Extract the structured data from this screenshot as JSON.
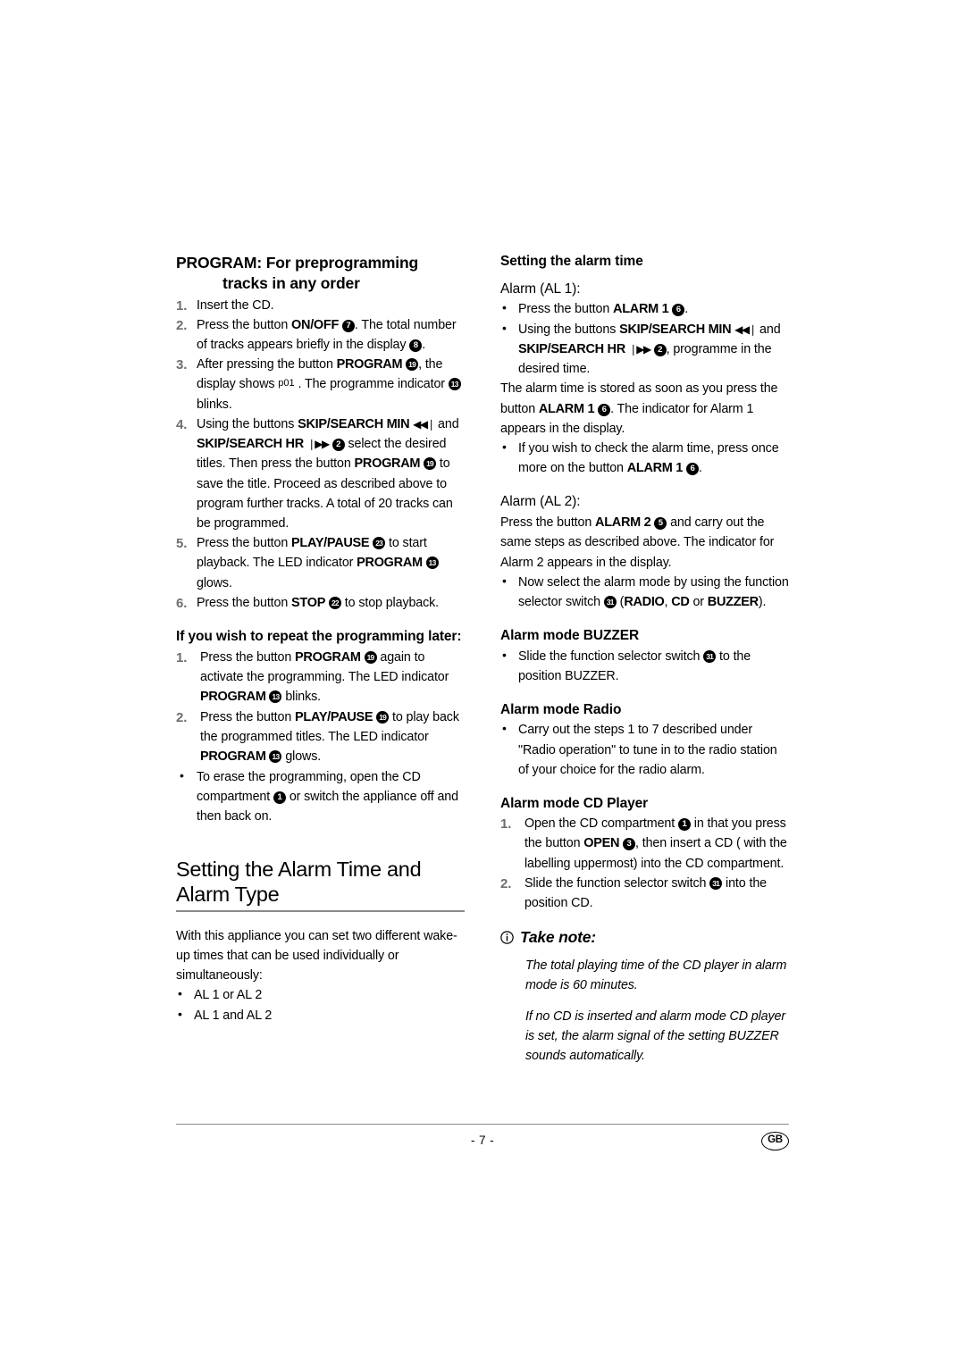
{
  "page": {
    "number_label": "- 7 -",
    "locale_badge": "GB"
  },
  "left_column": {
    "program_section": {
      "heading_line1": "PROGRAM: For preprogramming",
      "heading_line2": "tracks in any order",
      "steps": [
        {
          "num": "1.",
          "parts": [
            {
              "t": "text",
              "v": "Insert the CD."
            }
          ]
        },
        {
          "num": "2.",
          "parts": [
            {
              "t": "text",
              "v": "Press the button "
            },
            {
              "t": "label",
              "v": "ON/OFF"
            },
            {
              "t": "space",
              "v": " "
            },
            {
              "t": "ref",
              "v": "7"
            },
            {
              "t": "text",
              "v": ". The total number of tracks appears briefly in the display "
            },
            {
              "t": "ref",
              "v": "8"
            },
            {
              "t": "text",
              "v": "."
            }
          ]
        },
        {
          "num": "3.",
          "parts": [
            {
              "t": "text",
              "v": "After pressing the button "
            },
            {
              "t": "label",
              "v": "PROGRAM"
            },
            {
              "t": "space",
              "v": " "
            },
            {
              "t": "ref2",
              "v": "19"
            },
            {
              "t": "text",
              "v": ", the display shows "
            },
            {
              "t": "sup",
              "v": "p01"
            },
            {
              "t": "text",
              "v": " . The programme indicator "
            },
            {
              "t": "ref2",
              "v": "13"
            },
            {
              "t": "text",
              "v": " blinks."
            }
          ]
        },
        {
          "num": "4.",
          "parts": [
            {
              "t": "text",
              "v": "Using the buttons "
            },
            {
              "t": "label",
              "v": "SKIP/SEARCH MIN"
            },
            {
              "t": "space",
              "v": " "
            },
            {
              "t": "glyph",
              "v": "◀◀❘"
            },
            {
              "t": "text",
              "v": " and "
            },
            {
              "t": "label",
              "v": "SKIP/SEARCH HR"
            },
            {
              "t": "space",
              "v": " "
            },
            {
              "t": "glyph",
              "v": "❘▶▶"
            },
            {
              "t": "space",
              "v": " "
            },
            {
              "t": "ref",
              "v": "2"
            },
            {
              "t": "text",
              "v": " select the desired titles. Then press the button "
            },
            {
              "t": "label",
              "v": "PROGRAM"
            },
            {
              "t": "space",
              "v": " "
            },
            {
              "t": "ref2",
              "v": "19"
            },
            {
              "t": "text",
              "v": " to save the title. Proceed as described above to program further tracks. A total of 20 tracks can be programmed."
            }
          ]
        },
        {
          "num": "5.",
          "parts": [
            {
              "t": "text",
              "v": "Press the button "
            },
            {
              "t": "label",
              "v": "PLAY/PAUSE"
            },
            {
              "t": "space",
              "v": "  "
            },
            {
              "t": "ref2",
              "v": "23"
            },
            {
              "t": "text",
              "v": " to start playback. The LED indicator "
            },
            {
              "t": "label",
              "v": "PROGRAM"
            },
            {
              "t": "space",
              "v": " "
            },
            {
              "t": "ref2",
              "v": "13"
            },
            {
              "t": "text",
              "v": " glows."
            }
          ]
        },
        {
          "num": "6.",
          "parts": [
            {
              "t": "text",
              "v": "Press the button "
            },
            {
              "t": "label",
              "v": "STOP"
            },
            {
              "t": "space",
              "v": " "
            },
            {
              "t": "ref2",
              "v": "22"
            },
            {
              "t": "text",
              "v": " to stop playback."
            }
          ]
        }
      ]
    },
    "repeat_section": {
      "heading": "If you wish to repeat the programming later:",
      "steps": [
        {
          "num": "1.",
          "parts": [
            {
              "t": "text",
              "v": " Press the button "
            },
            {
              "t": "label",
              "v": "PROGRAM"
            },
            {
              "t": "space",
              "v": " "
            },
            {
              "t": "ref2",
              "v": "19"
            },
            {
              "t": "text",
              "v": " again to activate the programming. The LED indicator "
            },
            {
              "t": "label",
              "v": "PROGRAM"
            },
            {
              "t": "space",
              "v": " "
            },
            {
              "t": "ref2",
              "v": "13"
            },
            {
              "t": "text",
              "v": " blinks."
            }
          ]
        },
        {
          "num": "2.",
          "parts": [
            {
              "t": "text",
              "v": " Press the button "
            },
            {
              "t": "label",
              "v": "PLAY/PAUSE"
            },
            {
              "t": "space",
              "v": " "
            },
            {
              "t": "ref2",
              "v": "19"
            },
            {
              "t": "text",
              "v": " to play back the programmed titles. The LED indicator "
            },
            {
              "t": "label",
              "v": "PROGRAM"
            },
            {
              "t": "space",
              "v": " "
            },
            {
              "t": "ref2",
              "v": "13"
            },
            {
              "t": "text",
              "v": " glows."
            }
          ]
        }
      ],
      "bullets": [
        {
          "parts": [
            {
              "t": "text",
              "v": "To erase the programming, open the CD compartment "
            },
            {
              "t": "ref",
              "v": "1"
            },
            {
              "t": "text",
              "v": " or switch the appliance off and then back on."
            }
          ]
        }
      ]
    },
    "alarm_time_type_section": {
      "heading_line1": "Setting the Alarm Time and",
      "heading_line2": "Alarm Type",
      "intro": "With this appliance you can set two different wake-up times that can be used individually or simultaneously:",
      "bullets": [
        {
          "parts": [
            {
              "t": "text",
              "v": "AL 1 or AL 2"
            }
          ]
        },
        {
          "parts": [
            {
              "t": "text",
              "v": "AL 1 and AL 2"
            }
          ]
        }
      ]
    }
  },
  "right_column": {
    "alarm_time_heading": "Setting the alarm time",
    "alarm_al1": {
      "heading": "Alarm (AL 1):",
      "bullets": [
        {
          "parts": [
            {
              "t": "text",
              "v": "Press the button "
            },
            {
              "t": "label",
              "v": "ALARM 1"
            },
            {
              "t": "space",
              "v": " "
            },
            {
              "t": "ref",
              "v": "6"
            },
            {
              "t": "text",
              "v": "."
            }
          ]
        },
        {
          "parts": [
            {
              "t": "text",
              "v": "Using the buttons "
            },
            {
              "t": "label",
              "v": "SKIP/SEARCH MIN"
            },
            {
              "t": "space",
              "v": " "
            },
            {
              "t": "glyph",
              "v": "◀◀❘"
            },
            {
              "t": "text",
              "v": " and "
            },
            {
              "t": "label",
              "v": "SKIP/SEARCH HR"
            },
            {
              "t": "space",
              "v": " "
            },
            {
              "t": "glyph",
              "v": "❘▶▶"
            },
            {
              "t": "space",
              "v": " "
            },
            {
              "t": "ref",
              "v": "2"
            },
            {
              "t": "text",
              "v": ", programme in the desired time."
            }
          ]
        }
      ],
      "paragraph_parts": [
        {
          "t": "text",
          "v": "The alarm time is stored as soon as you press the button "
        },
        {
          "t": "label",
          "v": "ALARM 1"
        },
        {
          "t": "space",
          "v": " "
        },
        {
          "t": "ref",
          "v": "6"
        },
        {
          "t": "text",
          "v": ". The indicator for Alarm 1 appears in the display."
        }
      ],
      "bullets_after": [
        {
          "parts": [
            {
              "t": "text",
              "v": "If you wish to check the alarm time, press once more on the button "
            },
            {
              "t": "label",
              "v": "ALARM 1"
            },
            {
              "t": "space",
              "v": " "
            },
            {
              "t": "ref",
              "v": "6"
            },
            {
              "t": "text",
              "v": "."
            }
          ]
        }
      ]
    },
    "alarm_al2": {
      "heading": "Alarm (AL 2):",
      "paragraph_parts": [
        {
          "t": "text",
          "v": "Press the button "
        },
        {
          "t": "label",
          "v": "ALARM 2"
        },
        {
          "t": "space",
          "v": " "
        },
        {
          "t": "ref",
          "v": "5"
        },
        {
          "t": "text",
          "v": " and carry out the same steps as described above. The indicator for Alarm 2 appears in the display."
        }
      ],
      "bullets": [
        {
          "parts": [
            {
              "t": "text",
              "v": "Now select the alarm mode by using the function selector switch "
            },
            {
              "t": "ref2",
              "v": "31"
            },
            {
              "t": "text",
              "v": " ("
            },
            {
              "t": "label",
              "v": "RADIO"
            },
            {
              "t": "text",
              "v": ", "
            },
            {
              "t": "label",
              "v": "CD"
            },
            {
              "t": "text",
              "v": " or "
            },
            {
              "t": "label",
              "v": "BUZZER"
            },
            {
              "t": "text",
              "v": ")."
            }
          ]
        }
      ]
    },
    "mode_buzzer": {
      "heading": "Alarm mode BUZZER",
      "bullets": [
        {
          "parts": [
            {
              "t": "text",
              "v": "Slide the function selector switch "
            },
            {
              "t": "ref2",
              "v": "31"
            },
            {
              "t": "text",
              "v": " to the position BUZZER."
            }
          ]
        }
      ]
    },
    "mode_radio": {
      "heading": "Alarm mode Radio",
      "bullets": [
        {
          "parts": [
            {
              "t": "text",
              "v": "Carry out the steps 1 to 7 described under \"Radio operation\" to tune in to the radio station of your choice for the radio alarm."
            }
          ]
        }
      ]
    },
    "mode_cd": {
      "heading": "Alarm mode CD Player",
      "steps": [
        {
          "num": "1.",
          "parts": [
            {
              "t": "text",
              "v": " Open the CD compartment "
            },
            {
              "t": "ref",
              "v": "1"
            },
            {
              "t": "text",
              "v": " in that you press the button "
            },
            {
              "t": "label",
              "v": "OPEN"
            },
            {
              "t": "space",
              "v": " "
            },
            {
              "t": "ref",
              "v": "3"
            },
            {
              "t": "text",
              "v": ", then insert a CD ( with the labelling uppermost) into the CD compartment."
            }
          ]
        },
        {
          "num": "2.",
          "parts": [
            {
              "t": "text",
              "v": "Slide the function selector switch "
            },
            {
              "t": "ref2",
              "v": "31"
            },
            {
              "t": "text",
              "v": " into the position CD."
            }
          ]
        }
      ]
    },
    "take_note": {
      "title": "Take note:",
      "paragraphs": [
        "The total playing time of the CD player in alarm mode is 60 minutes.",
        "If no CD is inserted and alarm mode CD player is set, the alarm signal of the setting BUZZER sounds automatically."
      ]
    }
  }
}
